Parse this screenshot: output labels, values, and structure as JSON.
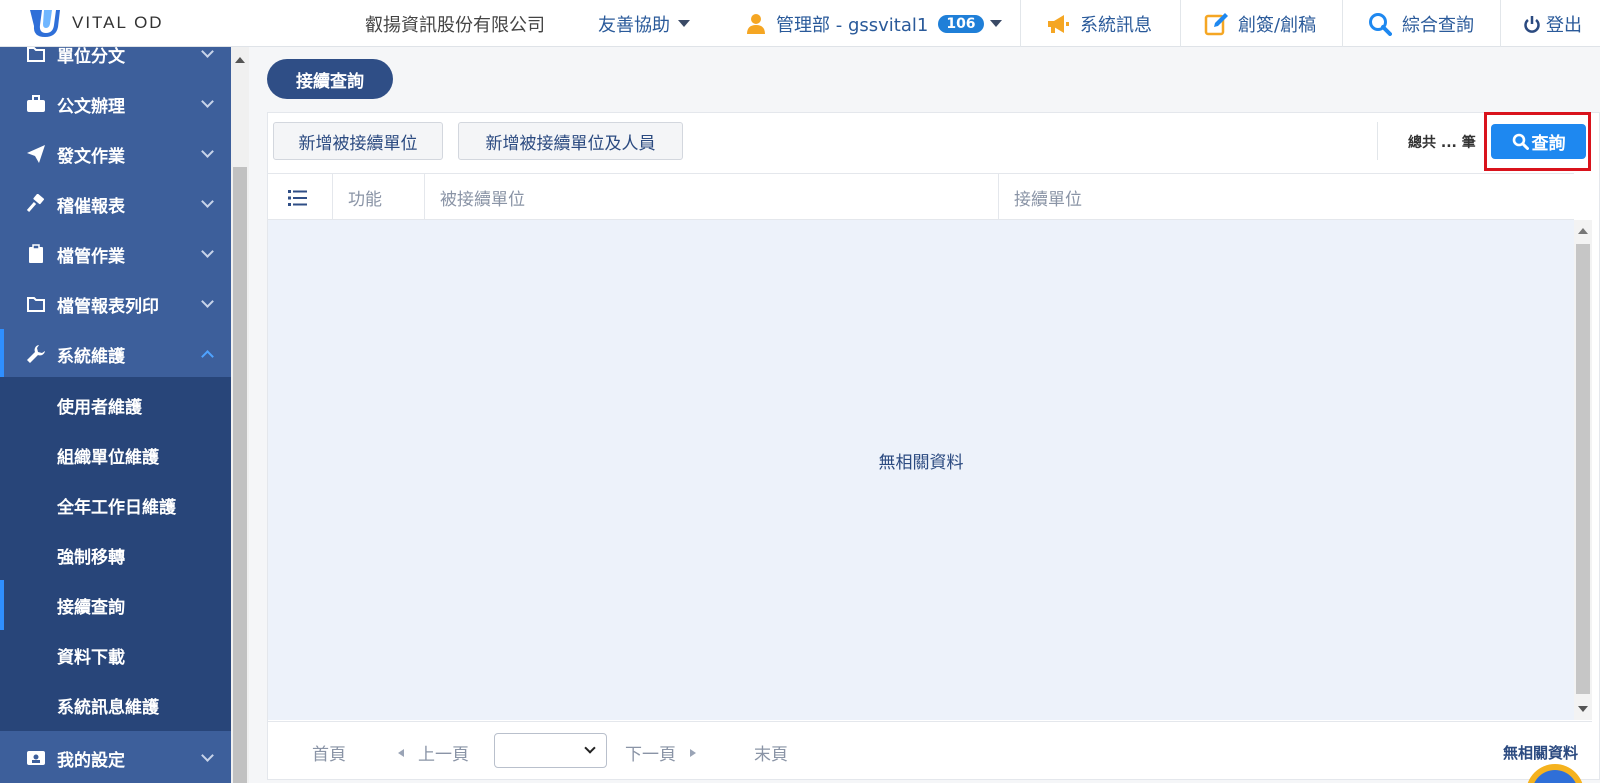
{
  "header": {
    "logo_text": "VITAL OD",
    "company": "叡揚資訊股份有限公司",
    "assist": "友善協助",
    "user": "管理部 - gssvital1",
    "badge": "106",
    "messages": "系統訊息",
    "compose": "創簽/創稿",
    "search": "綜合查詢",
    "logout": "登出"
  },
  "sidebar": {
    "items": [
      {
        "label": "單位分文",
        "icon": "folder-icon"
      },
      {
        "label": "公文辦理",
        "icon": "briefcase-icon"
      },
      {
        "label": "發文作業",
        "icon": "paper-plane-icon"
      },
      {
        "label": "稽催報表",
        "icon": "gavel-icon"
      },
      {
        "label": "檔管作業",
        "icon": "clipboard-icon"
      },
      {
        "label": "檔管報表列印",
        "icon": "folder-icon"
      },
      {
        "label": "系統維護",
        "icon": "wrench-icon"
      }
    ],
    "subitems": [
      {
        "label": "使用者維護"
      },
      {
        "label": "組織單位維護"
      },
      {
        "label": "全年工作日維護"
      },
      {
        "label": "強制移轉"
      },
      {
        "label": "接續查詢"
      },
      {
        "label": "資料下載"
      },
      {
        "label": "系統訊息維護"
      }
    ],
    "bottom_item": {
      "label": "我的設定",
      "icon": "id-card-icon"
    }
  },
  "main": {
    "page_title": "接續查詢",
    "toolbar": {
      "add_unit": "新增被接續單位",
      "add_unit_person": "新增被接續單位及人員",
      "total": "總共 ... 筆",
      "search": "查詢"
    },
    "table": {
      "columns": [
        "功能",
        "被接續單位",
        "接續單位"
      ],
      "empty": "無相關資料"
    },
    "pager": {
      "first": "首頁",
      "prev": "上一頁",
      "next": "下一頁",
      "last": "末頁",
      "status": "無相關資料"
    }
  },
  "colors": {
    "sidebar": "#3d5f9b",
    "submenu": "#284579",
    "accent": "#1e88f0",
    "highlight": "#d9131c",
    "title_pill": "#2f4e86"
  }
}
